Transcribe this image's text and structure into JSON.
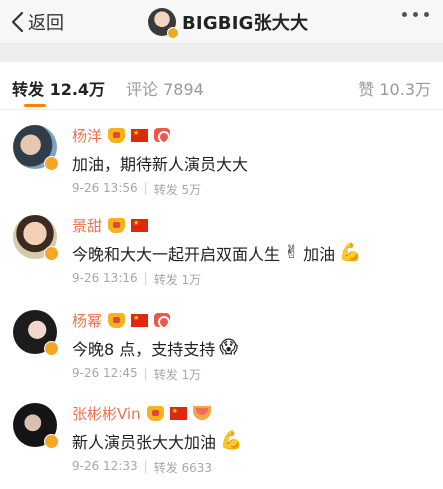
{
  "header": {
    "back_label": "返回",
    "title": "BIGBIG张大大"
  },
  "tabs": {
    "repost": "转发 12.4万",
    "comment": "评论 7894",
    "like": "赞 10.3万"
  },
  "reposts": [
    {
      "name": "杨洋",
      "badges": [
        "crown-icon",
        "china-flag-icon",
        "heart-badge-icon"
      ],
      "text": "加油，期待新人演员大大",
      "emoji": "",
      "tail": "",
      "tail_emoji": "",
      "time": "9-26 13:56",
      "reposts": "转发 5万"
    },
    {
      "name": "景甜",
      "badges": [
        "crown-icon",
        "china-flag-icon"
      ],
      "text": "今晚和大大一起开启双面人生",
      "emoji": "✌",
      "tail": "加油",
      "tail_emoji": "💪",
      "time": "9-26 13:16",
      "reposts": "转发 1万"
    },
    {
      "name": "杨幂",
      "badges": [
        "crown-icon",
        "china-flag-icon",
        "heart-badge-icon"
      ],
      "text": "今晚8 点，支持支持",
      "emoji": "😱",
      "tail": "",
      "tail_emoji": "",
      "time": "9-26 12:45",
      "reposts": "转发 1万"
    },
    {
      "name": "张彬彬Vin",
      "badges": [
        "crown-icon",
        "china-flag-icon",
        "melon-badge-icon"
      ],
      "text": "新人演员张大大加油",
      "emoji": "💪",
      "tail": "",
      "tail_emoji": "",
      "time": "9-26 12:33",
      "reposts": "转发 6633"
    }
  ],
  "colors": {
    "username": "#eb7350",
    "tab_accent": "#ff8200",
    "verified_badge": "#f5a623"
  }
}
